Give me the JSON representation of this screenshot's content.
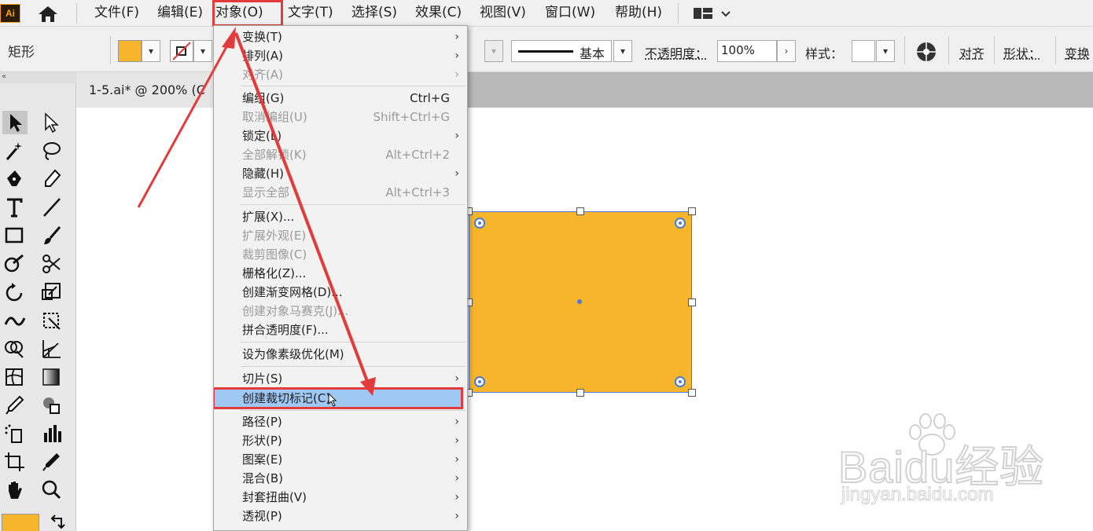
{
  "app": {
    "logo_text": "Ai"
  },
  "menubar": {
    "items": [
      {
        "label": "文件(F)"
      },
      {
        "label": "编辑(E)"
      },
      {
        "label": "对象(O)"
      },
      {
        "label": "文字(T)"
      },
      {
        "label": "选择(S)"
      },
      {
        "label": "效果(C)"
      },
      {
        "label": "视图(V)"
      },
      {
        "label": "窗口(W)"
      },
      {
        "label": "帮助(H)"
      }
    ],
    "active": "对象(O)"
  },
  "controlbar": {
    "shape_label": "矩形",
    "fill_color": "#f7b52c",
    "stroke_profile_label": "基本",
    "opacity_label": "不透明度：",
    "opacity_value": "100%",
    "style_label": "样式：",
    "align_label": "对齐",
    "shape_link": "形状：",
    "transform_label": "变换"
  },
  "document": {
    "tab_title": "1-5.ai* @ 200% (C"
  },
  "object_menu": {
    "groups": [
      [
        {
          "label": "变换(T)",
          "submenu": true,
          "enabled": true
        },
        {
          "label": "排列(A)",
          "submenu": true,
          "enabled": true
        },
        {
          "label": "对齐(A)",
          "submenu": true,
          "enabled": false
        }
      ],
      [
        {
          "label": "编组(G)",
          "shortcut": "Ctrl+G",
          "enabled": true
        },
        {
          "label": "取消编组(U)",
          "shortcut": "Shift+Ctrl+G",
          "enabled": false
        },
        {
          "label": "锁定(L)",
          "submenu": true,
          "enabled": true
        },
        {
          "label": "全部解锁(K)",
          "shortcut": "Alt+Ctrl+2",
          "enabled": false
        },
        {
          "label": "隐藏(H)",
          "submenu": true,
          "enabled": true
        },
        {
          "label": "显示全部",
          "shortcut": "Alt+Ctrl+3",
          "enabled": false
        }
      ],
      [
        {
          "label": "扩展(X)...",
          "enabled": true
        },
        {
          "label": "扩展外观(E)",
          "enabled": false
        },
        {
          "label": "裁剪图像(C)",
          "enabled": false
        },
        {
          "label": "栅格化(Z)...",
          "enabled": true
        },
        {
          "label": "创建渐变网格(D)...",
          "enabled": true
        },
        {
          "label": "创建对象马赛克(J)...",
          "enabled": false
        },
        {
          "label": "拼合透明度(F)...",
          "enabled": true
        }
      ],
      [
        {
          "label": "设为像素级优化(M)",
          "enabled": true
        }
      ],
      [
        {
          "label": "切片(S)",
          "submenu": true,
          "enabled": true
        },
        {
          "label": "创建裁切标记(C)",
          "enabled": true,
          "highlighted": true
        }
      ],
      [
        {
          "label": "路径(P)",
          "submenu": true,
          "enabled": true
        },
        {
          "label": "形状(P)",
          "submenu": true,
          "enabled": true
        },
        {
          "label": "图案(E)",
          "submenu": true,
          "enabled": true
        },
        {
          "label": "混合(B)",
          "submenu": true,
          "enabled": true
        },
        {
          "label": "封套扭曲(V)",
          "submenu": true,
          "enabled": true
        },
        {
          "label": "透视(P)",
          "submenu": true,
          "enabled": true
        }
      ]
    ]
  },
  "canvas": {
    "rect_fill": "#f7b52c",
    "selection_color": "#4b7bd6"
  },
  "watermark": {
    "brand": "Baidu经验",
    "url": "jingyan.baidu.com"
  },
  "annotation": {
    "color": "#e33b3b"
  }
}
